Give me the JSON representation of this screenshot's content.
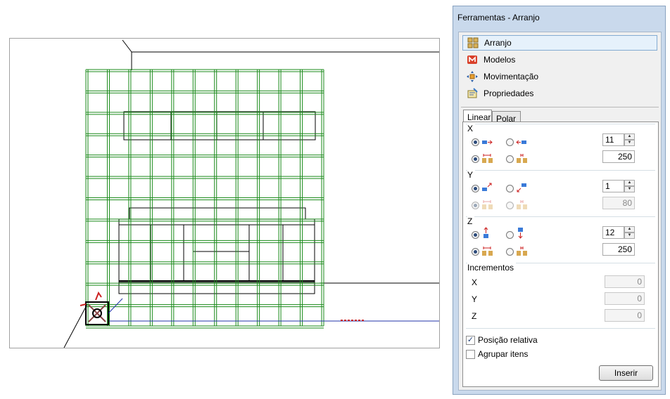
{
  "viewport": {
    "name": "3d-drawing-viewport"
  },
  "panel": {
    "title": "Ferramentas - Arranjo",
    "sections": [
      {
        "label": "Arranjo",
        "icon": "arranjo-icon"
      },
      {
        "label": "Modelos",
        "icon": "modelos-icon"
      },
      {
        "label": "Movimentação",
        "icon": "movimentacao-icon"
      },
      {
        "label": "Propriedades",
        "icon": "propriedades-icon"
      }
    ],
    "tabs": [
      "Linear",
      "Polar"
    ],
    "x": {
      "label": "X",
      "count": "11",
      "spacing": "250"
    },
    "y": {
      "label": "Y",
      "count": "1",
      "spacing": "80"
    },
    "z": {
      "label": "Z",
      "count": "12",
      "spacing": "250"
    },
    "increments": {
      "label": "Incrementos",
      "x_label": "X",
      "x_value": "0",
      "y_label": "Y",
      "y_value": "0",
      "z_label": "Z",
      "z_value": "0"
    },
    "relative_position": "Posição relativa",
    "group_items": "Agrupar itens",
    "insert_button": "Inserir"
  },
  "colors": {
    "grid": "#1a8a1a",
    "panel_bg": "#c9d9ec",
    "axis": "#2233aa"
  }
}
